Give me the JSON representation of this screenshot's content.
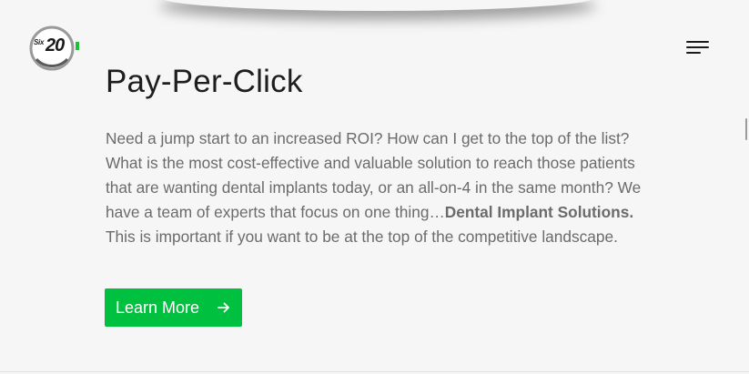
{
  "header": {
    "logo": {
      "prefix": "Six",
      "number": "20",
      "accent_color": "#1fbf3a"
    },
    "menu_icon": "hamburger-menu-icon"
  },
  "section": {
    "title": "Pay-Per-Click",
    "paragraph": {
      "part1": "Need a jump start to an increased ROI? How can I get to the top of the list? What is the most cost-effective and valuable solution to reach those patients that are wanting dental implants today, or an all-on-4 in the same month? We have a team of experts that focus on one thing…",
      "bold": "Dental Implant Solutions.",
      "part2": " This is important if you want to be at the top of the competitive landscape."
    },
    "cta": {
      "label": "Learn More",
      "icon": "arrow-right-icon",
      "color": "#00c13f"
    }
  }
}
